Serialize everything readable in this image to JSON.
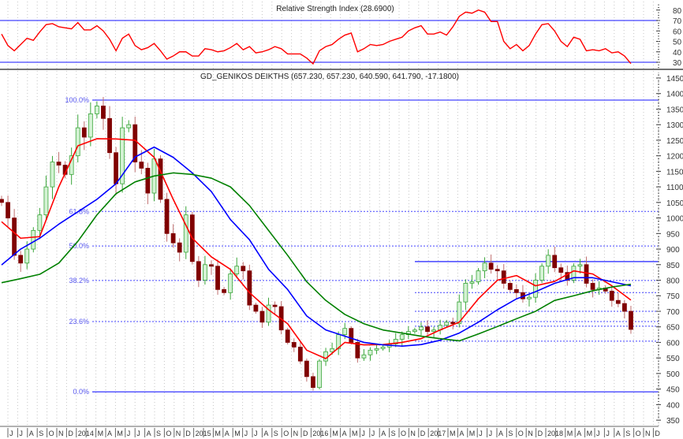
{
  "chart_data": {
    "type": "candlestick",
    "title": "GD_GENIKOS DEIKTHS (657.230, 657.230, 640.590, 641.790, -17.1800)",
    "interval": "2-week bars, Jun 2013 - Oct 2018",
    "first_open": 1060,
    "closes": [
      1050,
      1000,
      880,
      855,
      900,
      960,
      1010,
      1100,
      1180,
      1170,
      1140,
      1200,
      1290,
      1260,
      1335,
      1360,
      1320,
      1210,
      1110,
      1290,
      1300,
      1180,
      1160,
      1080,
      1190,
      1060,
      950,
      920,
      890,
      1010,
      860,
      800,
      850,
      845,
      770,
      760,
      820,
      845,
      830,
      720,
      700,
      665,
      720,
      715,
      640,
      600,
      585,
      540,
      490,
      455,
      540,
      570,
      580,
      625,
      645,
      600,
      550,
      560,
      575,
      580,
      585,
      595,
      610,
      625,
      635,
      640,
      650,
      635,
      640,
      655,
      665,
      660,
      730,
      790,
      795,
      830,
      855,
      835,
      830,
      790,
      770,
      760,
      740,
      745,
      800,
      845,
      880,
      840,
      825,
      800,
      845,
      850,
      790,
      770,
      775,
      765,
      735,
      725,
      700,
      641.79
    ],
    "moving_averages": {
      "sample_every_bars": 3,
      "series": [
        {
          "name": "MA short",
          "color": "#ff0000",
          "values": [
            988,
            935,
            940,
            1100,
            1232,
            1255,
            1254,
            1250,
            1195,
            1060,
            935,
            875,
            835,
            760,
            705,
            660,
            575,
            548,
            600,
            592,
            593,
            600,
            612,
            640,
            665,
            740,
            800,
            815,
            782,
            796,
            830,
            820,
            782,
            736
          ]
        },
        {
          "name": "MA medium",
          "color": "#0000ff",
          "values": [
            849,
            900,
            935,
            980,
            1020,
            1060,
            1110,
            1196,
            1228,
            1195,
            1145,
            1085,
            995,
            930,
            835,
            770,
            685,
            640,
            620,
            600,
            592,
            588,
            593,
            607,
            630,
            665,
            705,
            740,
            763,
            790,
            808,
            808,
            795,
            782
          ]
        },
        {
          "name": "MA long",
          "color": "#008000",
          "values": [
            792,
            805,
            819,
            855,
            925,
            1010,
            1078,
            1116,
            1135,
            1145,
            1140,
            1128,
            1100,
            1040,
            960,
            880,
            795,
            735,
            690,
            660,
            640,
            630,
            620,
            612,
            605,
            627,
            651,
            676,
            700,
            735,
            750,
            766,
            778,
            787
          ]
        }
      ]
    },
    "fibonacci": {
      "color": "#4444ff",
      "high": 1379,
      "low": 441,
      "levels": [
        {
          "label": "100.0%",
          "value": 1379,
          "style": "solid"
        },
        {
          "label": "61.8%",
          "value": 1021,
          "style": "dotted"
        },
        {
          "label": "50.0%",
          "value": 910,
          "style": "dotted"
        },
        {
          "label": "38.2%",
          "value": 799,
          "style": "dotted"
        },
        {
          "label": "23.6%",
          "value": 667,
          "style": "dotted"
        },
        {
          "label": "0.0%",
          "value": 441,
          "style": "solid"
        }
      ]
    },
    "support_resistance": [
      {
        "value": 860,
        "style": "solid"
      },
      {
        "value": 760,
        "style": "dotted"
      },
      {
        "value": 700,
        "style": "dotted"
      },
      {
        "value": 652,
        "style": "dotted"
      },
      {
        "value": 604,
        "style": "dotted"
      }
    ],
    "ylim": [
      350,
      1450
    ],
    "y_ticks": [
      350,
      400,
      450,
      500,
      550,
      600,
      650,
      700,
      750,
      800,
      850,
      900,
      950,
      1000,
      1050,
      1100,
      1150,
      1200,
      1250,
      1300,
      1350,
      1400,
      1450
    ],
    "x_month_labels": [
      "J",
      "J",
      "A",
      "S",
      "O",
      "N",
      "D",
      "2014",
      "",
      "M",
      "A",
      "M",
      "J",
      "J",
      "A",
      "S",
      "O",
      "N",
      "D",
      "2015",
      "",
      "M",
      "A",
      "M",
      "J",
      "J",
      "A",
      "S",
      "O",
      "N",
      "D",
      "2016",
      "",
      "M",
      "A",
      "M",
      "J",
      "J",
      "A",
      "S",
      "O",
      "N",
      "D",
      "2017",
      "",
      "M",
      "A",
      "M",
      "J",
      "J",
      "A",
      "S",
      "O",
      "N",
      "D",
      "2018",
      "",
      "M",
      "A",
      "M",
      "J",
      "J",
      "A",
      "S",
      "O",
      "N",
      "D"
    ],
    "rsi": {
      "title": "Relative Strength Index (28.6900)",
      "color": "#ff0000",
      "last": 28.69,
      "upper": 70,
      "lower": 30,
      "ylim": [
        25,
        85
      ],
      "y_ticks": [
        30,
        40,
        50,
        60,
        70,
        80
      ],
      "values": [
        57,
        46,
        41,
        47,
        53,
        51,
        59,
        66,
        67,
        64,
        63,
        62,
        68,
        61,
        61,
        65,
        60,
        52,
        41,
        53,
        57,
        46,
        42,
        44,
        48,
        41,
        33,
        36,
        40,
        40,
        36,
        36,
        43,
        42,
        40,
        41,
        44,
        48,
        42,
        45,
        39,
        40,
        42,
        45,
        43,
        38,
        38,
        38,
        34,
        28.5,
        41,
        45,
        47,
        52,
        56,
        58,
        40,
        43,
        47,
        46,
        47,
        50,
        52,
        54,
        60,
        63,
        65,
        57,
        57,
        59,
        56,
        64,
        74,
        78,
        77,
        80,
        78,
        69,
        69,
        50,
        43,
        47,
        41,
        46,
        57,
        66,
        67,
        60,
        50,
        45,
        54,
        52,
        41,
        42,
        41,
        43,
        39,
        40,
        36,
        28.69
      ]
    },
    "colors": {
      "up": "#3aa63a",
      "up_fill": "#d4f2d4",
      "down": "#800000",
      "down_wick": "#c07070",
      "ref_line": "#4444ff"
    }
  }
}
